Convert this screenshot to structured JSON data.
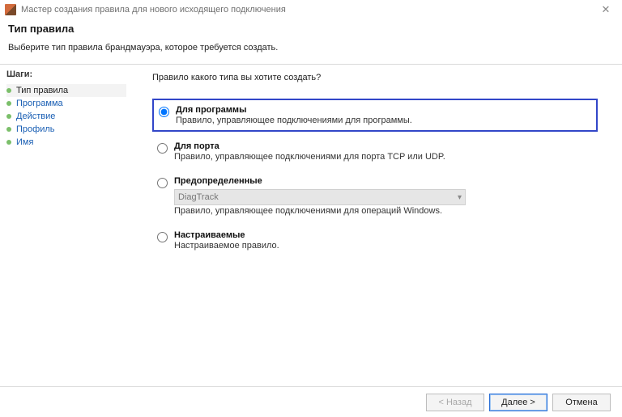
{
  "window": {
    "title": "Мастер создания правила для нового исходящего подключения",
    "close_glyph": "✕"
  },
  "header": {
    "title": "Тип правила",
    "subtitle": "Выберите тип правила брандмауэра, которое требуется создать."
  },
  "sidebar": {
    "heading": "Шаги:",
    "steps": [
      {
        "label": "Тип правила",
        "current": true
      },
      {
        "label": "Программа",
        "current": false
      },
      {
        "label": "Действие",
        "current": false
      },
      {
        "label": "Профиль",
        "current": false
      },
      {
        "label": "Имя",
        "current": false
      }
    ]
  },
  "content": {
    "question": "Правило какого типа вы хотите создать?",
    "options": [
      {
        "id": "program",
        "title": "Для программы",
        "desc": "Правило, управляющее подключениями для программы.",
        "checked": true,
        "highlight": true
      },
      {
        "id": "port",
        "title": "Для порта",
        "desc": "Правило, управляющее подключениями для порта TCP или UDP.",
        "checked": false
      },
      {
        "id": "predefined",
        "title": "Предопределенные",
        "desc": "Правило, управляющее подключениями для операций Windows.",
        "checked": false,
        "dropdown_value": "DiagTrack"
      },
      {
        "id": "custom",
        "title": "Настраиваемые",
        "desc": "Настраиваемое правило.",
        "checked": false
      }
    ]
  },
  "footer": {
    "back": "< Назад",
    "next": "Далее >",
    "cancel": "Отмена"
  }
}
